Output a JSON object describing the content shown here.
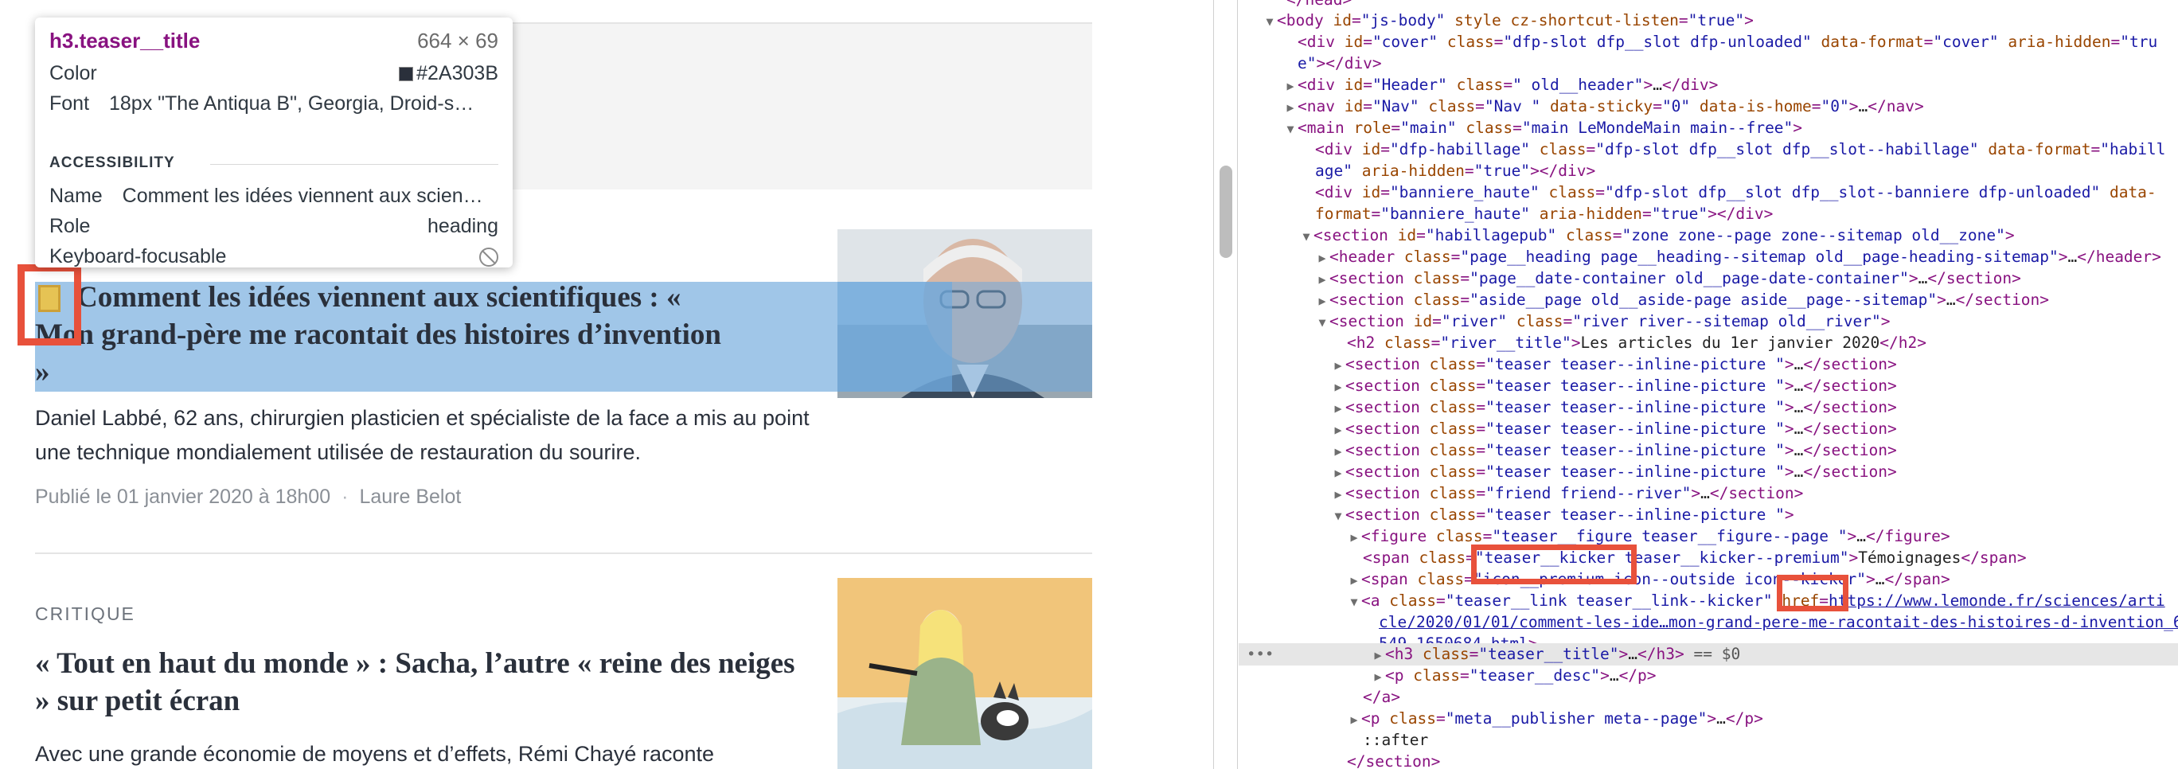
{
  "tooltip": {
    "selector": "h3.teaser__title",
    "dims": "664 × 69",
    "color_label": "Color",
    "color_value": "#2A303B",
    "font_label": "Font",
    "font_value": "18px \"The Antiqua B\", Georgia, Droid-s…",
    "accessibility_head": "ACCESSIBILITY",
    "name_label": "Name",
    "name_value": "Comment les idées viennent aux scien…",
    "role_label": "Role",
    "role_value": "heading",
    "kbd_label": "Keyboard-focusable"
  },
  "articles": [
    {
      "title_line1": "Comment les idées viennent aux scientifiques : «",
      "title_line2": "Mon grand-père me racontait des histoires d’invention",
      "title_line3": "»",
      "desc": "Daniel Labbé, 62 ans, chirurgien plasticien et spécialiste de la face a mis au point une technique mondialement utilisée de restauration du sourire.",
      "date": "Publié le 01 janvier 2020 à 18h00",
      "author": "Laure Belot"
    },
    {
      "kicker": "CRITIQUE",
      "title": "« Tout en haut du monde » : Sacha, l’autre « reine des neiges » sur petit écran",
      "desc": "Avec une grande économie de moyens et d’effets, Rémi Chayé raconte"
    }
  ],
  "meta_sep": "·",
  "devtools": {
    "lines": [
      {
        "t": "body_open"
      },
      {
        "t": "cover"
      },
      {
        "t": "cover_tail"
      },
      {
        "t": "header"
      },
      {
        "t": "nav"
      },
      {
        "t": "main"
      },
      {
        "t": "habillage"
      },
      {
        "t": "habillage_tail"
      },
      {
        "t": "banniere"
      },
      {
        "t": "banniere_tail"
      },
      {
        "t": "section_hab"
      },
      {
        "t": "header_page"
      },
      {
        "t": "date_container"
      },
      {
        "t": "aside"
      },
      {
        "t": "river"
      },
      {
        "t": "h2"
      }
    ],
    "h2_text": "Les articles du 1er janvier 2020",
    "kicker_text": "Témoignages",
    "href_value": "https://www.lemonde.fr/sciences/arti",
    "href_line2": "cle/2020/01/01/comment-les-ide…mon-grand-pere-me-racontait-des-histoires-d-invention_602",
    "href_line3": "549_1650684.html",
    "selected_suffix": "== $0",
    "after": "::after",
    "ellipsis": "…"
  }
}
